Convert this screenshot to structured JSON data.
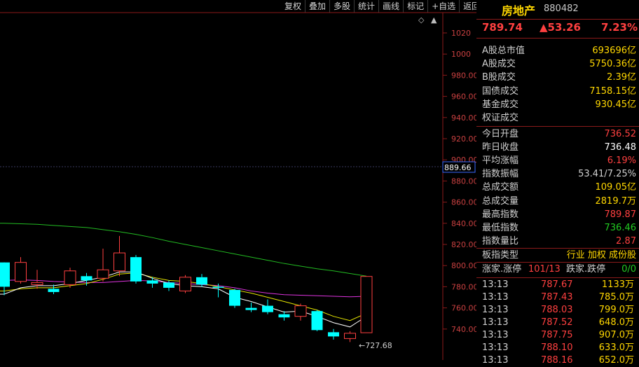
{
  "toolbar": [
    "复权",
    "叠加",
    "多股",
    "统计",
    "画线",
    "标记",
    "+自选",
    "返回"
  ],
  "chart": {
    "y_ticks": [
      "1020",
      "1000",
      "980.00",
      "960.00",
      "940.00",
      "920.00",
      "900.00",
      "880.00",
      "860.00",
      "840.00",
      "820.00",
      "800.00",
      "780.00",
      "760.00",
      "740.00"
    ],
    "crosshair_label": "889.66",
    "low_marker": "←727.68"
  },
  "chart_data": {
    "type": "candlestick",
    "ylim": [
      727,
      1030
    ],
    "candles": [
      {
        "o": 803,
        "c": 780,
        "h": 803,
        "l": 772
      },
      {
        "o": 785,
        "c": 803,
        "h": 808,
        "l": 783
      },
      {
        "o": 782,
        "c": 784,
        "h": 796,
        "l": 778
      },
      {
        "o": 778,
        "c": 775,
        "h": 782,
        "l": 773
      },
      {
        "o": 782,
        "c": 795,
        "h": 798,
        "l": 779
      },
      {
        "o": 790,
        "c": 786,
        "h": 793,
        "l": 781
      },
      {
        "o": 788,
        "c": 796,
        "h": 816,
        "l": 785
      },
      {
        "o": 795,
        "c": 812,
        "h": 828,
        "l": 790
      },
      {
        "o": 808,
        "c": 785,
        "h": 810,
        "l": 783
      },
      {
        "o": 786,
        "c": 783,
        "h": 789,
        "l": 779
      },
      {
        "o": 784,
        "c": 779,
        "h": 786,
        "l": 776
      },
      {
        "o": 776,
        "c": 789,
        "h": 791,
        "l": 774
      },
      {
        "o": 789,
        "c": 782,
        "h": 792,
        "l": 780
      },
      {
        "o": 780,
        "c": 779,
        "h": 783,
        "l": 770
      },
      {
        "o": 777,
        "c": 762,
        "h": 778,
        "l": 760
      },
      {
        "o": 760,
        "c": 758,
        "h": 765,
        "l": 756
      },
      {
        "o": 762,
        "c": 756,
        "h": 768,
        "l": 754
      },
      {
        "o": 754,
        "c": 751,
        "h": 757,
        "l": 748
      },
      {
        "o": 752,
        "c": 762,
        "h": 764,
        "l": 748
      },
      {
        "o": 757,
        "c": 739,
        "h": 758,
        "l": 738
      },
      {
        "o": 737,
        "c": 733,
        "h": 740,
        "l": 730
      },
      {
        "o": 731,
        "c": 736,
        "h": 738,
        "l": 727.68
      },
      {
        "o": 736.52,
        "c": 789.74,
        "h": 789.87,
        "l": 736.46
      }
    ],
    "ma_green": [
      840,
      839.5,
      839,
      838,
      837,
      836,
      834,
      832,
      829.5,
      826.5,
      823,
      820,
      817,
      814,
      811,
      808,
      805,
      802,
      799.5,
      797,
      795,
      792.5,
      790
    ],
    "ma_magenta": [
      786,
      786.5,
      786,
      785,
      784.5,
      784,
      784,
      785,
      786,
      785.5,
      784,
      783,
      782,
      781,
      779,
      776,
      774,
      772.5,
      772,
      771.5,
      771,
      770.5,
      771
    ],
    "ma_yellow": [
      776,
      778,
      779,
      779,
      781,
      783,
      787,
      792,
      793,
      789,
      786,
      785,
      783,
      780,
      777,
      774,
      770,
      766,
      762,
      758,
      752,
      748,
      755
    ],
    "ma_white": [
      773,
      779,
      781,
      781,
      783,
      786,
      789,
      794,
      794,
      788,
      783,
      781,
      780,
      778,
      770,
      766,
      761,
      756,
      757,
      752,
      746,
      742,
      752
    ]
  },
  "panel": {
    "name": "房地产",
    "code": "880482",
    "price": "789.74",
    "change": "▲53.26",
    "pct": "7.23%",
    "block1": [
      {
        "k": "A股总市值",
        "v": "693696亿"
      },
      {
        "k": "A股成交",
        "v": "5750.36亿"
      },
      {
        "k": "B股成交",
        "v": "2.39亿"
      },
      {
        "k": "国债成交",
        "v": "7158.15亿"
      },
      {
        "k": "基金成交",
        "v": "930.45亿"
      },
      {
        "k": "权证成交",
        "v": ""
      }
    ],
    "block2": [
      {
        "k": "今日开盘",
        "v": "736.52"
      },
      {
        "k": "昨日收盘",
        "v": "736.48"
      },
      {
        "k": "平均涨幅",
        "v": "6.19%"
      },
      {
        "k": "指数振幅",
        "v": "53.41/7.25%"
      },
      {
        "k": "总成交额",
        "v": "109.05亿"
      },
      {
        "k": "总成交量",
        "v": "2819.7万"
      },
      {
        "k": "最高指数",
        "v": "789.87"
      },
      {
        "k": "最低指数",
        "v": "736.46"
      },
      {
        "k": "指数量比",
        "v": "2.87"
      }
    ],
    "type_row": {
      "k": "板指类型",
      "v": "行业 加权 成份股"
    },
    "limit_row": {
      "up_label": "涨家.涨停",
      "up_val": "101/13",
      "down_label": "跌家.跌停",
      "down_val": "0/0"
    },
    "ticks": [
      {
        "t": "13:13",
        "p": "787.67",
        "v": "1133万"
      },
      {
        "t": "13:13",
        "p": "787.43",
        "v": "785.0万"
      },
      {
        "t": "13:13",
        "p": "788.03",
        "v": "799.0万"
      },
      {
        "t": "13:13",
        "p": "787.52",
        "v": "648.0万"
      },
      {
        "t": "13:13",
        "p": "787.75",
        "v": "907.0万"
      },
      {
        "t": "13:13",
        "p": "788.10",
        "v": "633.0万"
      },
      {
        "t": "13:13",
        "p": "788.16",
        "v": "652.0万"
      }
    ]
  },
  "colors": {
    "up": "#ff4040",
    "down": "#00ffff",
    "green": "#22bb22",
    "white": "#ffffff"
  }
}
